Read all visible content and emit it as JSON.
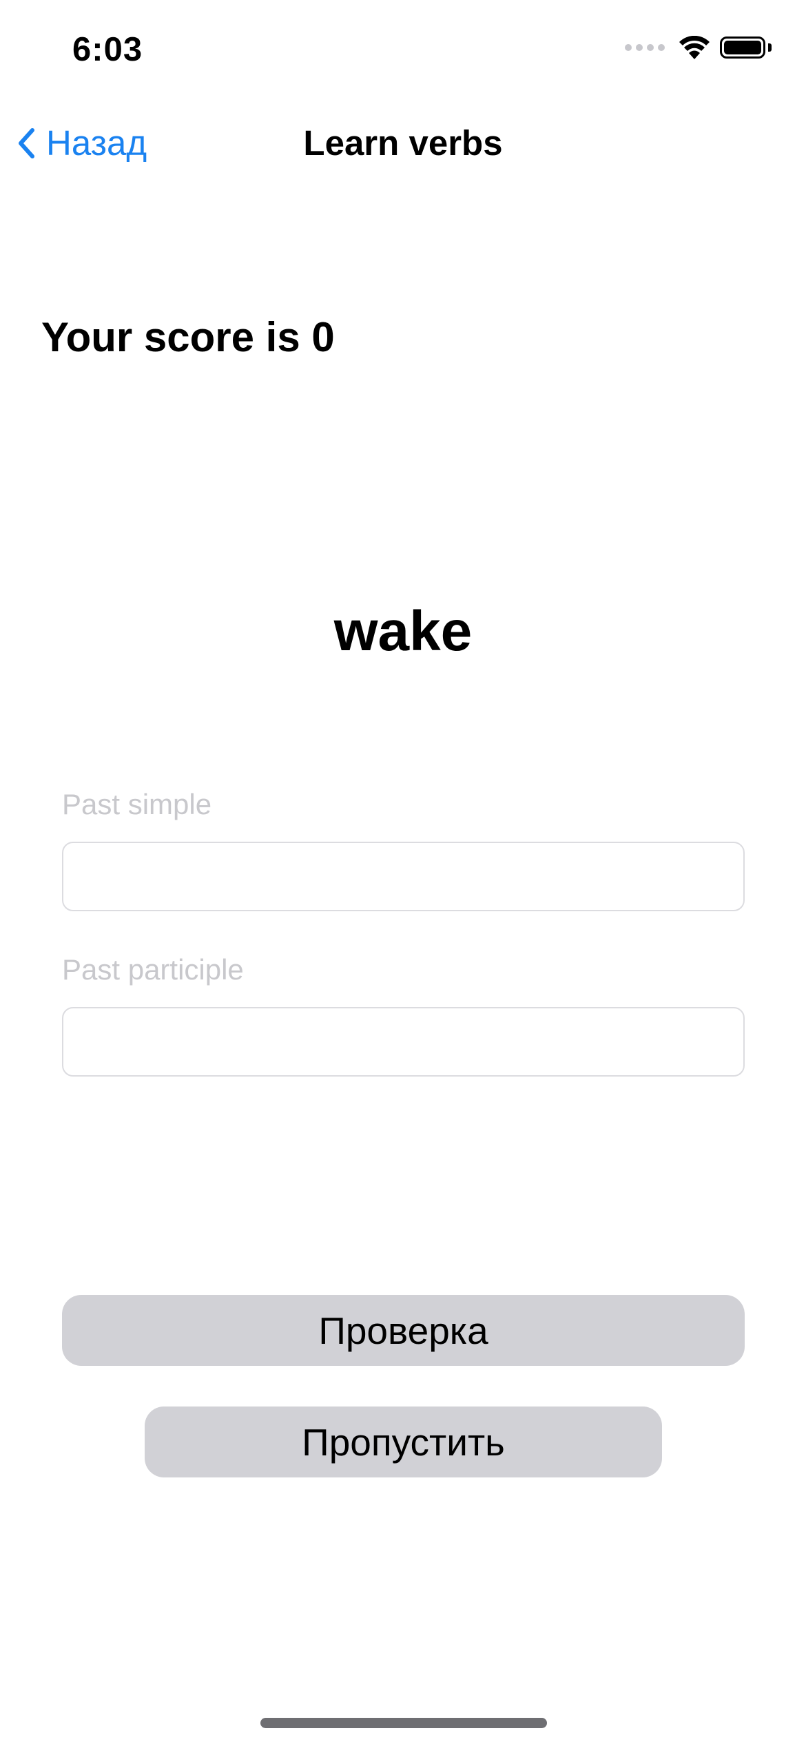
{
  "status_bar": {
    "time": "6:03",
    "icons": [
      "cellular-signal-icon",
      "wifi-icon",
      "battery-icon"
    ]
  },
  "nav": {
    "back_label": "Назад",
    "back_icon": "chevron-left-icon",
    "title": "Learn verbs",
    "accent_color": "#1a82f0"
  },
  "quiz": {
    "score_text": "Your score is 0",
    "verb": "wake",
    "fields": [
      {
        "label": "Past simple",
        "value": "",
        "placeholder": ""
      },
      {
        "label": "Past participle",
        "value": "",
        "placeholder": ""
      }
    ],
    "check_button": "Проверка",
    "skip_button": "Пропустить"
  }
}
